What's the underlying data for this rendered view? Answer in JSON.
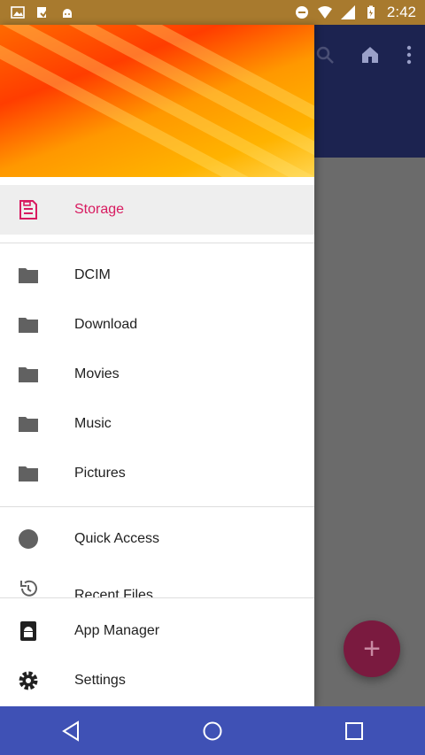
{
  "statusbar": {
    "time": "2:42"
  },
  "drawer": {
    "header_image": "orange abstract wallpaper",
    "storage_item": {
      "label": "Storage",
      "icon": "sd-storage-icon"
    },
    "folders": [
      {
        "label": "DCIM",
        "icon": "folder-icon"
      },
      {
        "label": "Download",
        "icon": "folder-icon"
      },
      {
        "label": "Movies",
        "icon": "folder-icon"
      },
      {
        "label": "Music",
        "icon": "folder-icon"
      },
      {
        "label": "Pictures",
        "icon": "folder-icon"
      }
    ],
    "extras": [
      {
        "label": "Quick Access",
        "icon": "circle-icon"
      },
      {
        "label": "Recent Files",
        "icon": "history-icon"
      }
    ],
    "footer_items": [
      {
        "label": "App Manager",
        "icon": "android-icon"
      },
      {
        "label": "Settings",
        "icon": "gear-icon"
      }
    ]
  },
  "fab": {
    "label": "+"
  },
  "colors": {
    "accent": "#d81b60",
    "appbar": "#1c2350",
    "navbar": "#3f51b5"
  }
}
